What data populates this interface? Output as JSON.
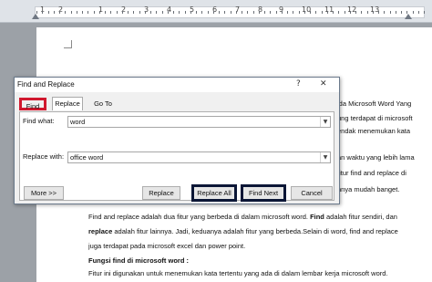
{
  "ruler": {
    "numbers": [
      "1",
      "2",
      "1",
      "2",
      "3",
      "4",
      "5",
      "6",
      "7",
      "8",
      "9",
      "10",
      "11",
      "12",
      "13"
    ]
  },
  "dialog": {
    "title": "Find and Replace",
    "help_glyph": "?",
    "close_glyph": "✕",
    "tabs": [
      "Find",
      "Replace",
      "Go To"
    ],
    "find_label": "Find what:",
    "find_value": "word",
    "replace_label": "Replace with:",
    "replace_value": "office word",
    "buttons": {
      "more": "More >>",
      "replace": "Replace",
      "replace_all": "Replace All",
      "find_next": "Find Next",
      "cancel": "Cancel"
    },
    "highlight_colors": {
      "tabs": "#d0182e",
      "buttons": "#0b1636"
    }
  },
  "document": {
    "right_fragments": [
      "ida Microsoft Word Yang",
      "ung terdapat di microsoft",
      "endak menemukan kata",
      "",
      "an waktu yang lebih lama",
      "fitur find and replace di",
      "nnya mudah banget."
    ],
    "para1": {
      "l1_pre": "Find and replace adalah dua fitur yang berbeda di dalam microsoft word. ",
      "l1_bold": "Find",
      "l1_post": " adalah fitur sendiri, dan",
      "l2_bold": "replace",
      "l2_post": " adalah fitur lainnya. Jadi, keduanya adalah fitur yang berbeda.Selain di word, find and replace",
      "l3": "juga terdapat pada microsoft excel dan power point."
    },
    "heading": "Fungsi find di microsoft word :",
    "para2": "Fitur ini digunakan untuk menemukan kata tertentu yang ada di dalam lembar kerja microsoft word."
  }
}
